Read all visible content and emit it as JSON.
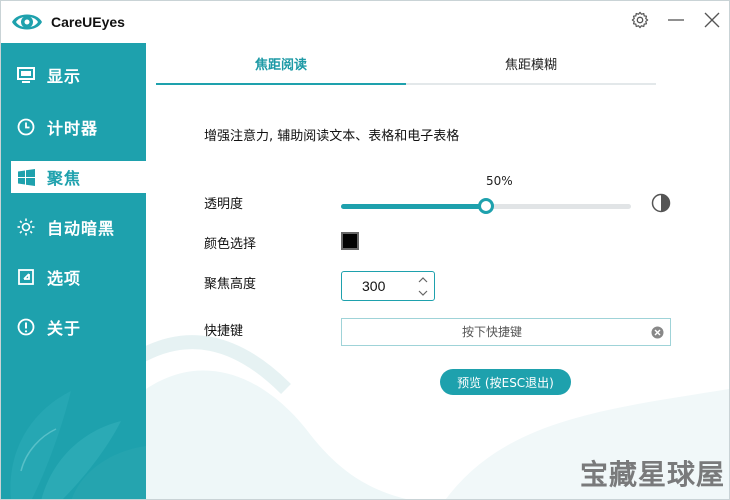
{
  "app": {
    "title": "CareUEyes"
  },
  "window_controls": {
    "settings_icon": "gear-icon",
    "minimize_icon": "minimize-icon",
    "close_icon": "close-icon"
  },
  "sidebar": {
    "items": [
      {
        "label": "显示",
        "icon": "monitor-icon"
      },
      {
        "label": "计时器",
        "icon": "clock-icon"
      },
      {
        "label": "聚焦",
        "icon": "windows-icon",
        "active": true
      },
      {
        "label": "自动暗黑",
        "icon": "sun-icon"
      },
      {
        "label": "选项",
        "icon": "options-icon"
      },
      {
        "label": "关于",
        "icon": "info-icon"
      }
    ]
  },
  "tabs": [
    {
      "label": "焦距阅读",
      "active": true
    },
    {
      "label": "焦距模糊",
      "active": false
    }
  ],
  "main": {
    "description": "增强注意力, 辅助阅读文本、表格和电子表格",
    "opacity": {
      "label": "透明度",
      "value_text": "50%",
      "value": 0.5
    },
    "color": {
      "label": "颜色选择",
      "value": "#000000"
    },
    "height": {
      "label": "聚焦高度",
      "value": "300"
    },
    "hotkey": {
      "label": "快捷键",
      "placeholder": "按下快捷键"
    },
    "preview_button": "预览 (按ESC退出)"
  },
  "watermark": "宝藏星球屋",
  "colors": {
    "accent": "#1ea1ad",
    "sidebar": "#1ea1ad"
  }
}
